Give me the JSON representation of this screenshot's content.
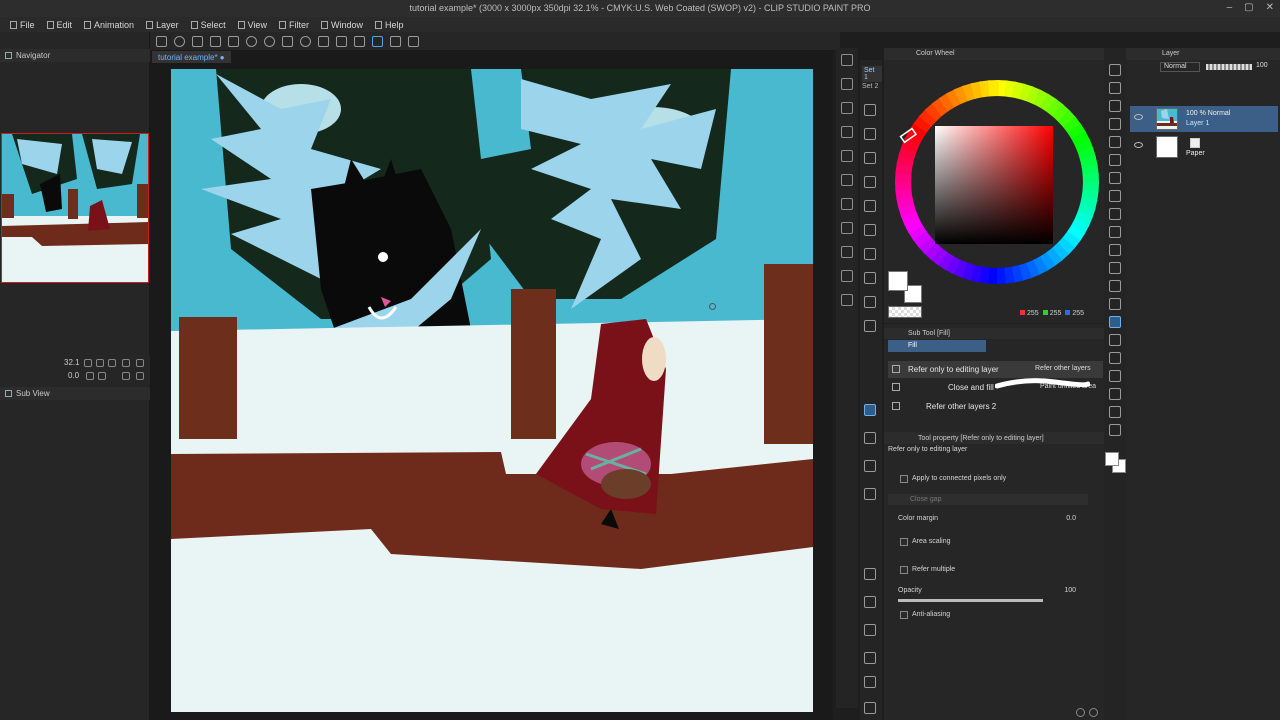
{
  "window": {
    "title": "tutorial example* (3000 x 3000px 350dpi 32.1% - CMYK:U.S. Web Coated (SWOP) v2) - CLIP STUDIO PAINT PRO",
    "controls": [
      "–",
      "▢",
      "✕"
    ]
  },
  "menu": [
    "File",
    "Edit",
    "Animation",
    "Layer",
    "Select",
    "View",
    "Filter",
    "Window",
    "Help"
  ],
  "left_panel": {
    "navigator_tab": "Navigator",
    "zoom": "32.1",
    "rotation": "0.0",
    "subview_tab": "Sub View"
  },
  "canvas": {
    "document_tab": "tutorial example* ●"
  },
  "tool_sets": {
    "set1": "Set 1",
    "set2": "Set 2"
  },
  "color_panel": {
    "tab_label": "Color Wheel",
    "main_color": "#ffffff",
    "sub_color": "#ffffff",
    "rgb": {
      "r": "255",
      "g": "255",
      "b": "255"
    },
    "hue_marker_color": "#ff0000"
  },
  "sub_tool": {
    "title": "Sub Tool [Fill]",
    "group_tab": "Fill",
    "items": [
      {
        "label": "Refer only to editing layer",
        "right_label": "Refer other layers",
        "selected": true
      },
      {
        "label": "Close and fill",
        "right_label": "Paint unfilled area",
        "selected": false
      },
      {
        "label": "Refer other layers 2",
        "right_label": "",
        "selected": false
      }
    ]
  },
  "tool_property": {
    "title": "Tool property [Refer only to editing layer]",
    "subtitle": "Refer only to editing layer",
    "apply_connected": "Apply to connected pixels only",
    "close_gap": "Close gap",
    "color_margin_label": "Color margin",
    "color_margin_value": "0.0",
    "area_scaling": "Area scaling",
    "refer_multiple": "Refer multiple",
    "opacity_label": "Opacity",
    "opacity_value": "100",
    "anti_aliasing": "Anti-aliasing"
  },
  "layer_panel": {
    "tab_label": "Layer",
    "blend_mode": "Normal",
    "opacity": "100",
    "layers": [
      {
        "name_line1": "100 % Normal",
        "name_line2": "Layer 1",
        "selected": true
      },
      {
        "name_line1": "Paper",
        "name_line2": "",
        "selected": false
      }
    ]
  },
  "colors": {
    "accent": "#3b5f86",
    "sky": "#48b9cf",
    "trees_dark": "#14291c",
    "tree_light": "#9cd4ec",
    "snow": "#e9f4f5",
    "trunk": "#6e2e1c",
    "path": "#6e2a1a",
    "hood": "#7a1119"
  }
}
